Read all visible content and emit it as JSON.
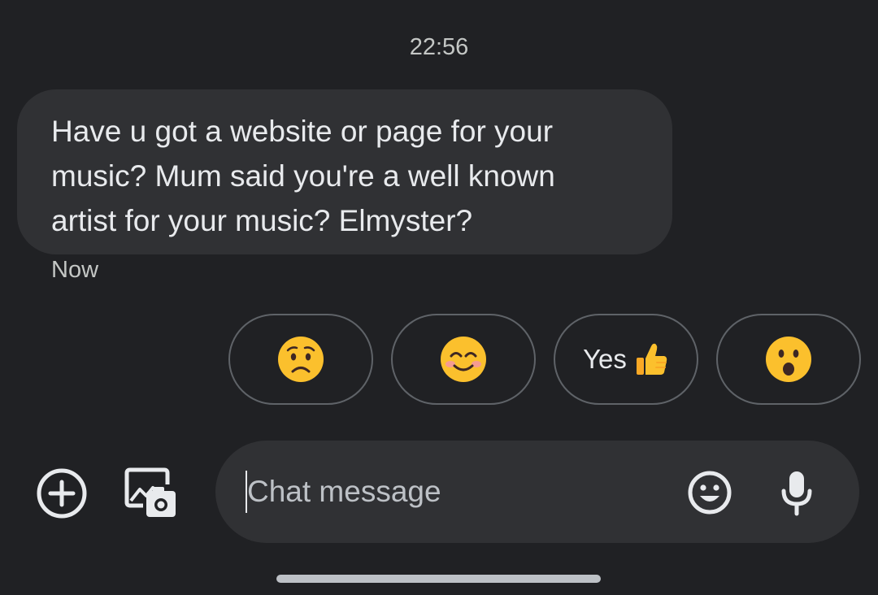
{
  "conversation": {
    "timestamp": "22:56",
    "incoming_message": {
      "lines": [
        "Have u got a website or page for your",
        "music? Mum said you're a well known",
        "artist for your music? Elmyster?"
      ],
      "time": "Now"
    }
  },
  "smart_replies": [
    {
      "kind": "emoji",
      "icon": "worried-face-icon"
    },
    {
      "kind": "emoji",
      "icon": "smiling-face-icon"
    },
    {
      "kind": "text",
      "label": "Yes",
      "icon": "thumbs-up-icon"
    },
    {
      "kind": "emoji",
      "icon": "surprised-face-icon"
    }
  ],
  "composer": {
    "placeholder": "Chat message",
    "value": "",
    "left_icons": [
      "add-icon",
      "gallery-camera-icon"
    ],
    "right_icons": [
      "emoji-icon",
      "microphone-icon"
    ]
  },
  "colors": {
    "background": "#202124",
    "bubble": "#303134",
    "text": "#e8eaed",
    "muted_text": "#c4c7c5",
    "chip_border": "#5f6368",
    "emoji_yellow": "#fbc02d"
  }
}
